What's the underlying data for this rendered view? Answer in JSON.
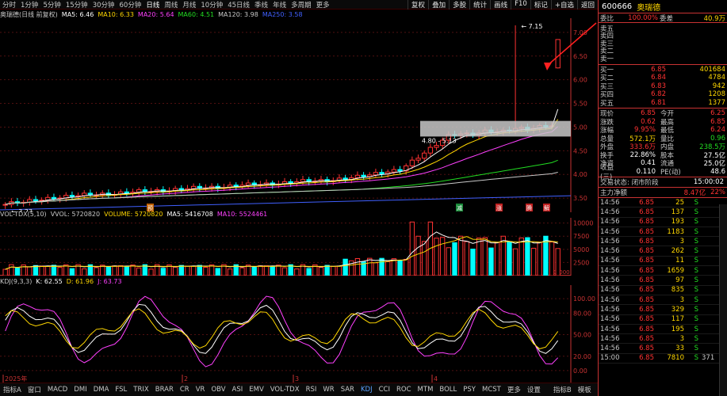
{
  "toolbar": {
    "items": [
      "分时",
      "1分钟",
      "5分钟",
      "15分钟",
      "30分钟",
      "60分钟",
      "日线",
      "周线",
      "月线",
      "10分钟",
      "45日线",
      "季线",
      "年线",
      "多周期",
      "更多"
    ],
    "active_index": 6,
    "right_items": [
      "复权",
      "叠加",
      "多股",
      "统计",
      "画线",
      "F10",
      "标记",
      "+自选",
      "返回"
    ]
  },
  "kline_legend": {
    "title": "奥瑞德(日线 前复权)",
    "ma5": "MA5: 6.46",
    "ma10": "MA10: 6.33",
    "ma20": "MA20: 5.64",
    "ma60": "MA60: 4.51",
    "ma120": "MA120: 3.98",
    "ma250": "MA250: 3.58"
  },
  "kline_axis": [
    "7.00",
    "6.50",
    "6.00",
    "5.50",
    "5.00",
    "4.50",
    "4.00",
    "3.50"
  ],
  "kline_annotations": {
    "high_label": "7.15",
    "low_label": "3.23",
    "box_label": "4.80 - 5.13",
    "markers": [
      "预",
      "减",
      "涨",
      "腾",
      "解"
    ]
  },
  "vol_legend": {
    "title": "VOL-TDX(5,10)",
    "vvol": "VVOL: 5720820",
    "volume": "VOLUME: 5720820",
    "ma5": "MA5: 5416708",
    "ma10": "MA10: 5524461"
  },
  "vol_axis": [
    "10000",
    "7500",
    "5000",
    "2500"
  ],
  "vol_unit": "X1000",
  "kdj_legend": {
    "title": "KDJ(9,3,3)",
    "k": "K: 62.55",
    "d": "D: 61.96",
    "j": "J: 63.73"
  },
  "kdj_axis": [
    "100.00",
    "80.00",
    "50.00",
    "20.00",
    "0.00"
  ],
  "time_axis": [
    "2025年",
    "2",
    "3",
    "4"
  ],
  "tabbar": {
    "items": [
      "指标A",
      "窗口",
      "MACD",
      "DMI",
      "DMA",
      "FSL",
      "TRIX",
      "BRAR",
      "CR",
      "VR",
      "OBV",
      "ASI",
      "EMV",
      "VOL-TDX",
      "RSI",
      "WR",
      "SAR",
      "KDJ",
      "CCI",
      "ROC",
      "MTM",
      "BOLL",
      "PSY",
      "MCST",
      "更多",
      "设置"
    ],
    "active_index": 17,
    "right_items": [
      "指标B",
      "模板"
    ]
  },
  "right_tab": "日线",
  "panel": {
    "code": "600666",
    "name": "奥瑞德",
    "weibi_label": "委比",
    "weibi_value": "100.00%",
    "weicha_label": "委差",
    "weicha_value": "40.9万",
    "asks": [
      {
        "label": "卖五",
        "price": "",
        "vol": ""
      },
      {
        "label": "卖四",
        "price": "",
        "vol": ""
      },
      {
        "label": "卖三",
        "price": "",
        "vol": ""
      },
      {
        "label": "卖二",
        "price": "",
        "vol": ""
      },
      {
        "label": "卖一",
        "price": "",
        "vol": ""
      }
    ],
    "bids": [
      {
        "label": "买一",
        "price": "6.85",
        "vol": "401684"
      },
      {
        "label": "买二",
        "price": "6.84",
        "vol": "4784"
      },
      {
        "label": "买三",
        "price": "6.83",
        "vol": "942"
      },
      {
        "label": "买四",
        "price": "6.82",
        "vol": "1208"
      },
      {
        "label": "买五",
        "price": "6.81",
        "vol": "1377"
      }
    ],
    "quote": [
      {
        "k1": "现价",
        "v1": "6.85",
        "k2": "今开",
        "v2": "6.25",
        "c1": "red",
        "c2": "red"
      },
      {
        "k1": "涨跌",
        "v1": "0.62",
        "k2": "最高",
        "v2": "6.85",
        "c1": "red",
        "c2": "red"
      },
      {
        "k1": "涨幅",
        "v1": "9.95%",
        "k2": "最低",
        "v2": "6.24",
        "c1": "red",
        "c2": "red"
      },
      {
        "k1": "总量",
        "v1": "572.1万",
        "k2": "量比",
        "v2": "0.96",
        "c1": "yellow",
        "c2": "green"
      },
      {
        "k1": "外盘",
        "v1": "333.6万",
        "k2": "内盘",
        "v2": "238.5万",
        "c1": "red",
        "c2": "green"
      },
      {
        "k1": "换手",
        "v1": "22.86%",
        "k2": "股本",
        "v2": "27.5亿",
        "c1": "white",
        "c2": "white"
      },
      {
        "k1": "净资",
        "v1": "0.41",
        "k2": "流通",
        "v2": "25.0亿",
        "c1": "white",
        "c2": "white"
      },
      {
        "k1": "收益(三)",
        "v1": "0.110",
        "k2": "PE(动)",
        "v2": "48.6",
        "c1": "white",
        "c2": "white"
      }
    ],
    "status_label": "交易状态: 闭市阶段",
    "status_time": "15:00:02",
    "netflow_label": "主力净额",
    "netflow_value": "8.47亿",
    "netflow_pct": "22%",
    "ticks": [
      {
        "t": "14:56",
        "p": "6.85",
        "v": "25",
        "s": "S"
      },
      {
        "t": "14:56",
        "p": "6.85",
        "v": "137",
        "s": "S"
      },
      {
        "t": "14:56",
        "p": "6.85",
        "v": "193",
        "s": "S"
      },
      {
        "t": "14:56",
        "p": "6.85",
        "v": "1183",
        "s": "S"
      },
      {
        "t": "14:56",
        "p": "6.85",
        "v": "3",
        "s": "S"
      },
      {
        "t": "14:56",
        "p": "6.85",
        "v": "262",
        "s": "S"
      },
      {
        "t": "14:56",
        "p": "6.85",
        "v": "11",
        "s": "S"
      },
      {
        "t": "14:56",
        "p": "6.85",
        "v": "1659",
        "s": "S"
      },
      {
        "t": "14:56",
        "p": "6.85",
        "v": "97",
        "s": "S"
      },
      {
        "t": "14:56",
        "p": "6.85",
        "v": "835",
        "s": "S"
      },
      {
        "t": "14:56",
        "p": "6.85",
        "v": "3",
        "s": "S"
      },
      {
        "t": "14:56",
        "p": "6.85",
        "v": "329",
        "s": "S"
      },
      {
        "t": "14:56",
        "p": "6.85",
        "v": "117",
        "s": "S"
      },
      {
        "t": "14:56",
        "p": "6.85",
        "v": "195",
        "s": "S"
      },
      {
        "t": "14:56",
        "p": "6.85",
        "v": "3",
        "s": "S"
      },
      {
        "t": "14:56",
        "p": "6.85",
        "v": "33",
        "s": "S"
      },
      {
        "t": "15:00",
        "p": "6.85",
        "v": "7810",
        "s": "S"
      }
    ],
    "tick_trailing": "371",
    "colors": {
      "up": "#ff3232",
      "down": "#00ffff",
      "border": "#c83232",
      "accent": "#ffd700"
    }
  }
}
